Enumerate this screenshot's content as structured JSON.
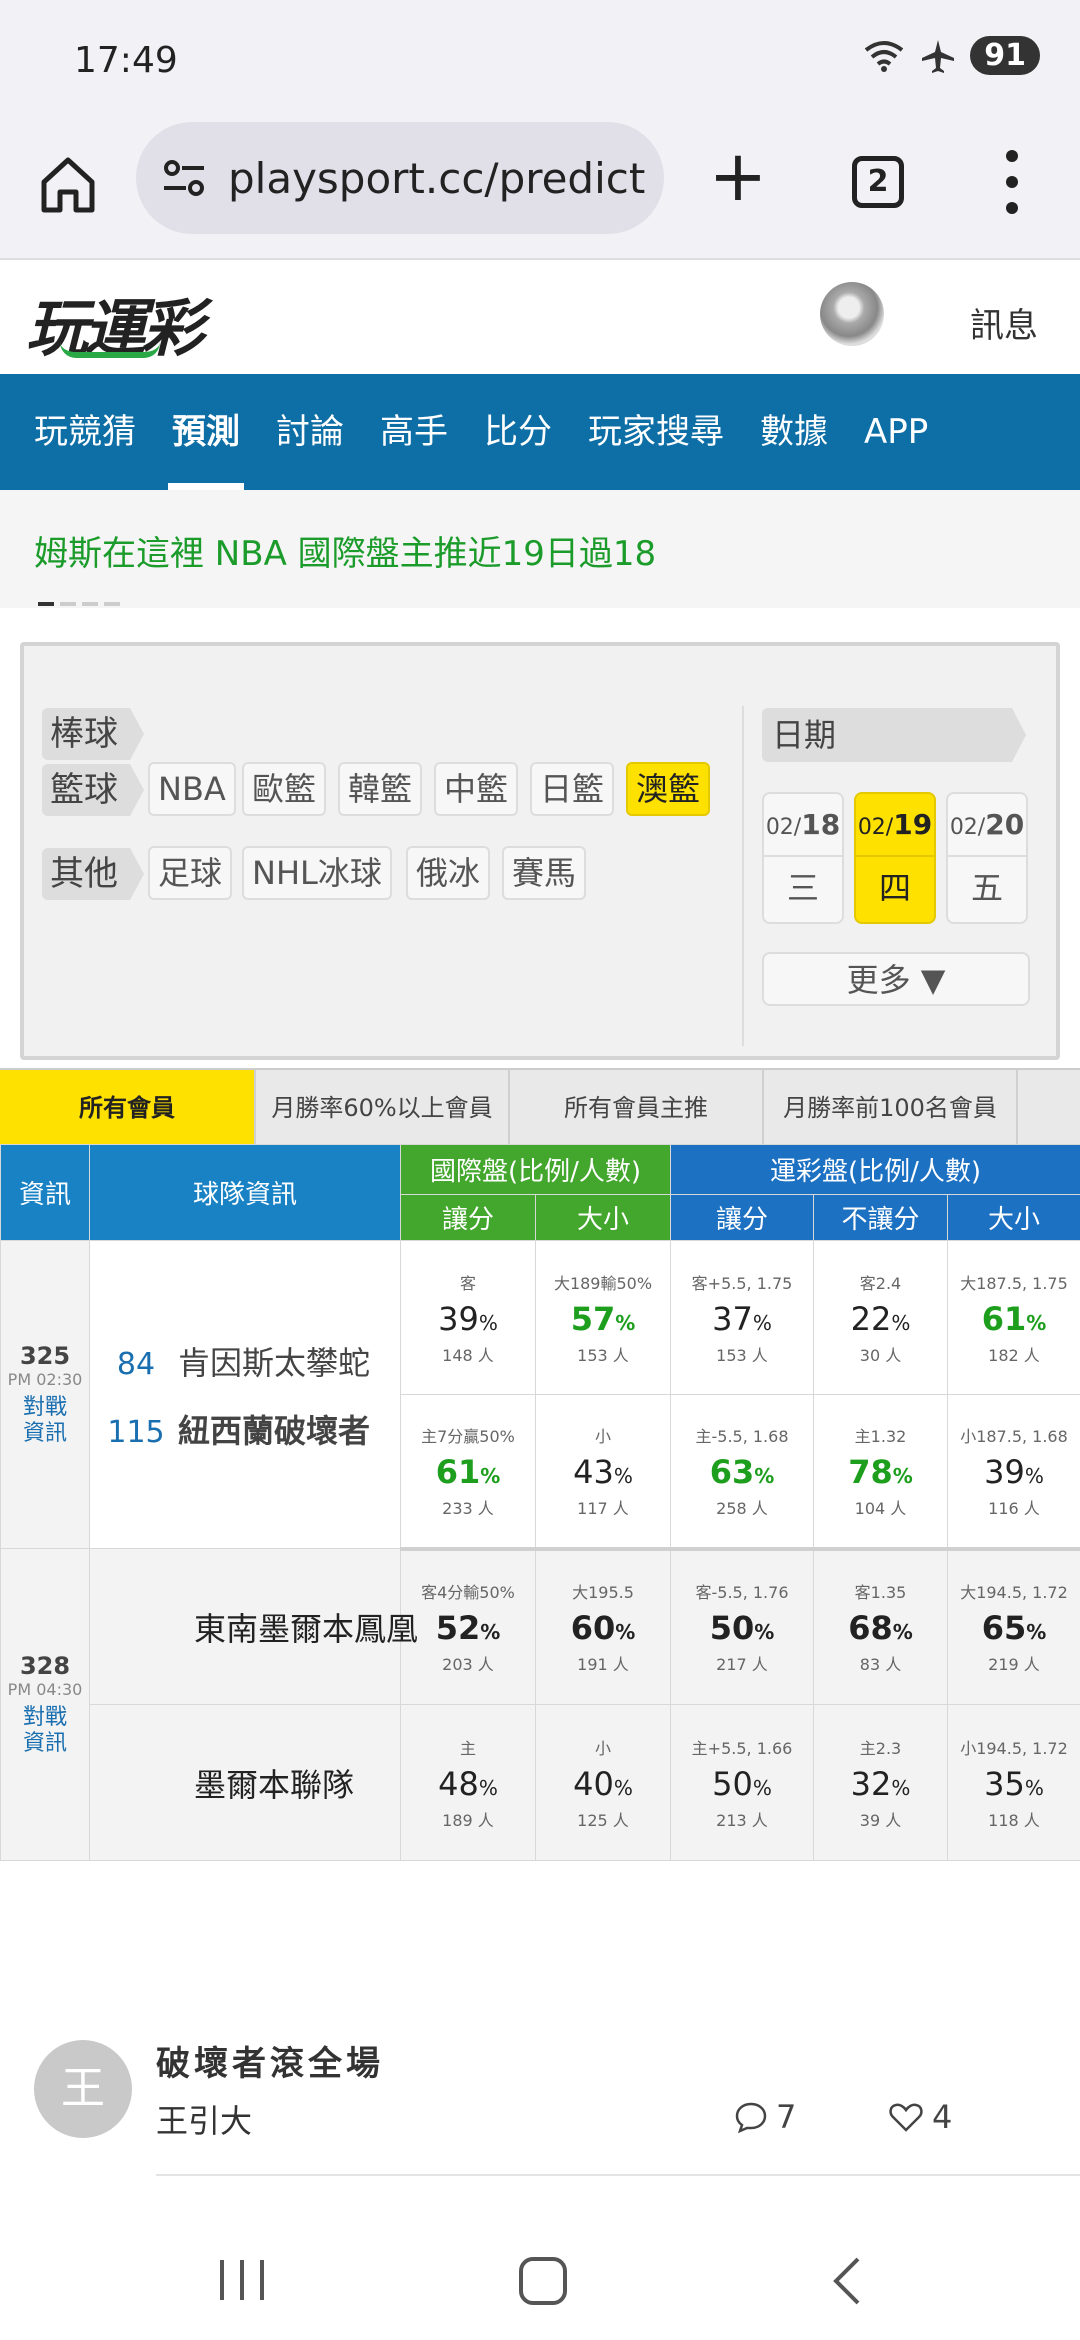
{
  "status": {
    "time": "17:49",
    "battery": "91"
  },
  "browser": {
    "url": "playsport.cc/predict",
    "tab_count": "2"
  },
  "site": {
    "logo": "玩運彩",
    "msg_link": "訊息"
  },
  "nav": [
    "玩競猜",
    "預測",
    "討論",
    "高手",
    "比分",
    "玩家搜尋",
    "數據",
    "APP"
  ],
  "ticker": "姆斯在這裡 NBA 國際盤主推近19日過18",
  "filter": {
    "cat_baseball": "棒球",
    "cat_basketball": "籃球",
    "cat_other": "其他",
    "basketball": [
      "NBA",
      "歐籃",
      "韓籃",
      "中籃",
      "日籃",
      "澳籃"
    ],
    "other": [
      "足球",
      "NHL冰球",
      "俄冰",
      "賽馬"
    ],
    "date_label": "日期",
    "dates": [
      {
        "m": "02/",
        "d": "18",
        "w": "三"
      },
      {
        "m": "02/",
        "d": "19",
        "w": "四"
      },
      {
        "m": "02/",
        "d": "20",
        "w": "五"
      }
    ],
    "more": "更多 ▼"
  },
  "member_tabs": [
    "所有會員",
    "月勝率60%以上會員",
    "所有會員主推",
    "月勝率前100名會員"
  ],
  "table": {
    "h_info": "資訊",
    "h_team": "球隊資訊",
    "h_intl": "國際盤(比例/人數)",
    "h_sport": "運彩盤(比例/人數)",
    "h_spread": "讓分",
    "h_ou": "大小",
    "h_spread2": "讓分",
    "h_ml": "不讓分",
    "h_ou2": "大小",
    "pct": "%",
    "g1": {
      "id": "325",
      "time": "PM 02:30",
      "link1": "對戰",
      "link2": "資訊",
      "away_score": "84",
      "away": "肯因斯太攀蛇",
      "home_score": "115",
      "home": "紐西蘭破壞者",
      "r1": [
        {
          "l": "客",
          "p": "39",
          "c": "148 人"
        },
        {
          "l": "大189輸50%",
          "p": "57",
          "c": "153 人"
        },
        {
          "l": "客+5.5, 1.75",
          "p": "37",
          "c": "153 人"
        },
        {
          "l": "客2.4",
          "p": "22",
          "c": "30 人"
        },
        {
          "l": "大187.5, 1.75",
          "p": "61",
          "c": "182 人"
        }
      ],
      "r2": [
        {
          "l": "主7分贏50%",
          "p": "61",
          "c": "233 人"
        },
        {
          "l": "小",
          "p": "43",
          "c": "117 人"
        },
        {
          "l": "主-5.5, 1.68",
          "p": "63",
          "c": "258 人"
        },
        {
          "l": "主1.32",
          "p": "78",
          "c": "104 人"
        },
        {
          "l": "小187.5, 1.68",
          "p": "39",
          "c": "116 人"
        }
      ]
    },
    "g2": {
      "id": "328",
      "time": "PM 04:30",
      "link1": "對戰",
      "link2": "資訊",
      "away": "東南墨爾本鳳凰",
      "home": "墨爾本聯隊",
      "r1": [
        {
          "l": "客4分輸50%",
          "p": "52",
          "c": "203 人"
        },
        {
          "l": "大195.5",
          "p": "60",
          "c": "191 人"
        },
        {
          "l": "客-5.5, 1.76",
          "p": "50",
          "c": "217 人"
        },
        {
          "l": "客1.35",
          "p": "68",
          "c": "83 人"
        },
        {
          "l": "大194.5, 1.72",
          "p": "65",
          "c": "219 人"
        }
      ],
      "r2": [
        {
          "l": "主",
          "p": "48",
          "c": "189 人"
        },
        {
          "l": "小",
          "p": "40",
          "c": "125 人"
        },
        {
          "l": "主+5.5, 1.66",
          "p": "50",
          "c": "213 人"
        },
        {
          "l": "主2.3",
          "p": "32",
          "c": "39 人"
        },
        {
          "l": "小194.5, 1.72",
          "p": "35",
          "c": "118 人"
        }
      ]
    }
  },
  "post": {
    "avatar": "王",
    "title": "破壞者滾全場",
    "author": "王引大",
    "comments": "7",
    "likes": "4"
  },
  "colors": {
    "brand_blue": "#0e6ea6",
    "highlight_yellow": "#ffe100",
    "green": "#1d9e1d"
  }
}
